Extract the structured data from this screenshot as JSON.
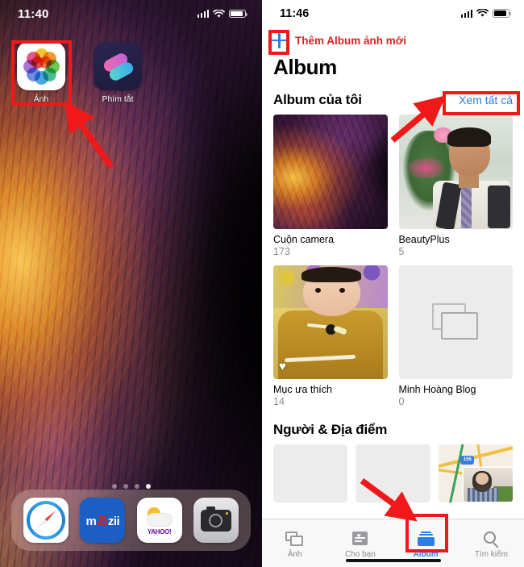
{
  "home": {
    "status": {
      "time": "11:40",
      "signal_icon": "cellular-bars-icon",
      "wifi_icon": "wifi-icon",
      "battery_icon": "battery-icon"
    },
    "apps": [
      {
        "label": "Ảnh",
        "icon": "photos-app-icon"
      },
      {
        "label": "Phím tắt",
        "icon": "shortcuts-app-icon"
      }
    ],
    "page_dots": {
      "count": 4,
      "active_index": 3
    },
    "dock": [
      {
        "label": "Safari",
        "icon": "safari-icon"
      },
      {
        "label": "Mazii",
        "icon": "mazii-icon",
        "text": "m",
        "accent": "あ",
        "text2": "zii"
      },
      {
        "label": "Yahoo Thời tiết",
        "icon": "yahoo-weather-icon",
        "brand": "YAHOO!"
      },
      {
        "label": "Camera",
        "icon": "camera-icon"
      }
    ]
  },
  "photos": {
    "status": {
      "time": "11:46",
      "signal_icon": "cellular-bars-icon",
      "wifi_icon": "wifi-icon",
      "battery_icon": "battery-icon"
    },
    "add_annotation": {
      "plus_icon": "plus-icon",
      "label": "Thêm Album ảnh mới"
    },
    "nav_title": "Album",
    "sections": [
      {
        "title": "Album của tôi",
        "link": "Xem tất cả"
      },
      {
        "title": "Người & Địa điểm"
      }
    ],
    "albums": [
      {
        "name": "Cuộn camera",
        "count": "173",
        "thumb": "marble-wallpaper-thumb"
      },
      {
        "name": "BeautyPlus",
        "count": "5",
        "thumb": "man-portrait-thumb"
      },
      {
        "name": "Mục ưa thích",
        "count": "14",
        "thumb": "baby-photo-thumb",
        "badge_icon": "heart-icon"
      },
      {
        "name": "Minh Hoàng Blog",
        "count": "0",
        "thumb": "empty-album-placeholder-icon"
      }
    ],
    "people_places": [
      {
        "thumb": "empty-person-thumb"
      },
      {
        "thumb": "empty-person-thumb"
      },
      {
        "thumb": "map-places-thumb",
        "map_shield": "155"
      }
    ],
    "tabs": [
      {
        "label": "Ảnh",
        "icon": "photos-stack-icon",
        "active": false
      },
      {
        "label": "Cho bạn",
        "icon": "for-you-icon",
        "active": false
      },
      {
        "label": "Album",
        "icon": "album-icon",
        "active": true
      },
      {
        "label": "Tìm kiếm",
        "icon": "search-icon",
        "active": false
      }
    ]
  },
  "annotations": {
    "accent_color": "#f01818",
    "boxes": [
      {
        "name": "photos-app-highlight"
      },
      {
        "name": "plus-button-highlight"
      },
      {
        "name": "view-all-highlight"
      },
      {
        "name": "album-tab-highlight"
      }
    ],
    "arrows": [
      {
        "name": "arrow-to-photos-app"
      },
      {
        "name": "arrow-to-view-all"
      },
      {
        "name": "arrow-to-album-tab"
      }
    ]
  }
}
